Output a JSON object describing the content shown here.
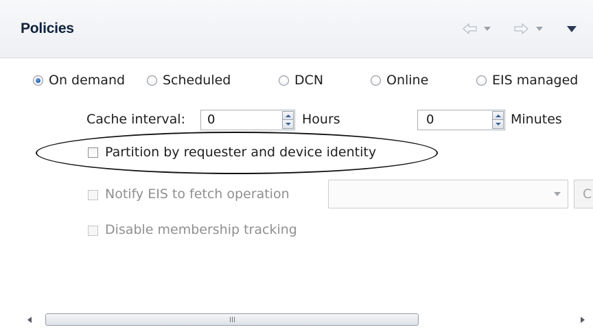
{
  "header": {
    "title": "Policies",
    "icons": [
      "back-arrow-icon",
      "back-dropdown-icon",
      "forward-arrow-icon",
      "forward-dropdown-icon",
      "view-menu-icon"
    ]
  },
  "policy_options": [
    {
      "label": "On demand",
      "selected": true
    },
    {
      "label": "Scheduled",
      "selected": false
    },
    {
      "label": "DCN",
      "selected": false
    },
    {
      "label": "Online",
      "selected": false
    },
    {
      "label": "EIS managed",
      "selected": false
    }
  ],
  "cache_interval": {
    "label": "Cache interval:",
    "hours_value": "0",
    "hours_label": "Hours",
    "minutes_value": "0",
    "minutes_label": "Minutes"
  },
  "partition": {
    "label": "Partition by requester and device identity",
    "checked": false
  },
  "notify": {
    "label": "Notify EIS to fetch operation",
    "checked": false,
    "enabled": false,
    "combo_value": "",
    "button_label": "C"
  },
  "membership": {
    "label": "Disable membership tracking",
    "checked": false,
    "enabled": false
  },
  "scrollbar": {
    "grip": "III"
  },
  "colors": {
    "annotation_outline": "#111111",
    "selected_radio": "#1d5fb4",
    "disabled_text": "#8f8f8f"
  }
}
